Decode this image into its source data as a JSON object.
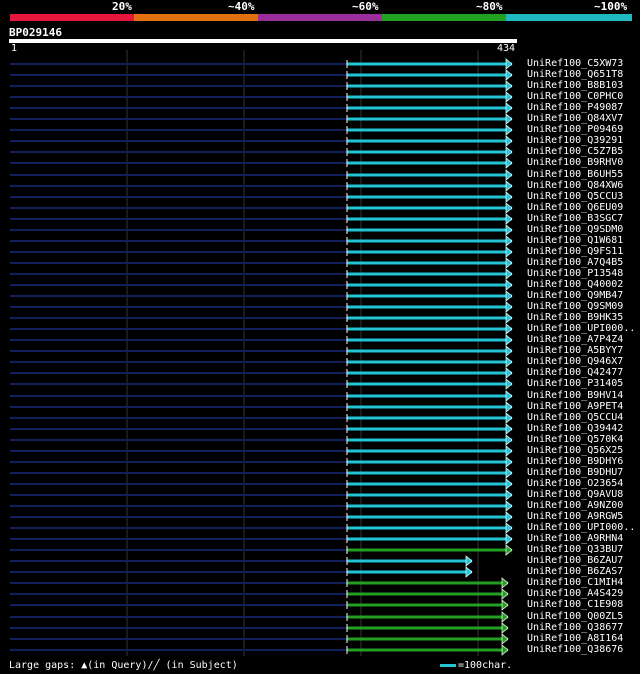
{
  "identity_scale": {
    "labels": [
      "20%",
      "~40%",
      "~60%",
      "~80%",
      "~100%"
    ],
    "colors": [
      "#e8163c",
      "#e07010",
      "#9b2e9b",
      "#22a022",
      "#20b8c0"
    ]
  },
  "query": {
    "name": "BP029146",
    "start": "1",
    "end": "434"
  },
  "hits": [
    {
      "name": "UniRef100_C5XW73",
      "color": "#22c4d6",
      "identity_pct": 100
    },
    {
      "name": "UniRef100_Q651T8",
      "color": "#22c4d6",
      "identity_pct": 100
    },
    {
      "name": "UniRef100_B8B103",
      "color": "#22c4d6",
      "identity_pct": 100
    },
    {
      "name": "UniRef100_C0PHC0",
      "color": "#22c4d6",
      "identity_pct": 100
    },
    {
      "name": "UniRef100_P49087",
      "color": "#22c4d6",
      "identity_pct": 100
    },
    {
      "name": "UniRef100_Q84XV7",
      "color": "#22c4d6",
      "identity_pct": 100
    },
    {
      "name": "UniRef100_P09469",
      "color": "#22c4d6",
      "identity_pct": 100
    },
    {
      "name": "UniRef100_Q39291",
      "color": "#22c4d6",
      "identity_pct": 100
    },
    {
      "name": "UniRef100_C5Z7B5",
      "color": "#22c4d6",
      "identity_pct": 100
    },
    {
      "name": "UniRef100_B9RHV0",
      "color": "#22c4d6",
      "identity_pct": 100
    },
    {
      "name": "UniRef100_B6UH55",
      "color": "#22c4d6",
      "identity_pct": 100
    },
    {
      "name": "UniRef100_Q84XW6",
      "color": "#22c4d6",
      "identity_pct": 100
    },
    {
      "name": "UniRef100_Q5CCU3",
      "color": "#22c4d6",
      "identity_pct": 100
    },
    {
      "name": "UniRef100_Q6EU09",
      "color": "#22c4d6",
      "identity_pct": 100
    },
    {
      "name": "UniRef100_B3SGC7",
      "color": "#22c4d6",
      "identity_pct": 100
    },
    {
      "name": "UniRef100_Q9SDM0",
      "color": "#22c4d6",
      "identity_pct": 100
    },
    {
      "name": "UniRef100_Q1W681",
      "color": "#22c4d6",
      "identity_pct": 100
    },
    {
      "name": "UniRef100_Q9FS11",
      "color": "#22c4d6",
      "identity_pct": 100
    },
    {
      "name": "UniRef100_A7Q4B5",
      "color": "#22c4d6",
      "identity_pct": 100
    },
    {
      "name": "UniRef100_P13548",
      "color": "#22c4d6",
      "identity_pct": 100
    },
    {
      "name": "UniRef100_Q40002",
      "color": "#22c4d6",
      "identity_pct": 100
    },
    {
      "name": "UniRef100_Q9MB47",
      "color": "#22c4d6",
      "identity_pct": 100
    },
    {
      "name": "UniRef100_Q9SM09",
      "color": "#22c4d6",
      "identity_pct": 100
    },
    {
      "name": "UniRef100_B9HK35",
      "color": "#22c4d6",
      "identity_pct": 100
    },
    {
      "name": "UniRef100_UPI000..",
      "color": "#22c4d6",
      "identity_pct": 100
    },
    {
      "name": "UniRef100_A7P4Z4",
      "color": "#22c4d6",
      "identity_pct": 100
    },
    {
      "name": "UniRef100_A5BYY7",
      "color": "#22c4d6",
      "identity_pct": 100
    },
    {
      "name": "UniRef100_Q946X7",
      "color": "#22c4d6",
      "identity_pct": 100
    },
    {
      "name": "UniRef100_Q42477",
      "color": "#22c4d6",
      "identity_pct": 100
    },
    {
      "name": "UniRef100_P31405",
      "color": "#22c4d6",
      "identity_pct": 100
    },
    {
      "name": "UniRef100_B9HV14",
      "color": "#22c4d6",
      "identity_pct": 100
    },
    {
      "name": "UniRef100_A9PET4",
      "color": "#22c4d6",
      "identity_pct": 100
    },
    {
      "name": "UniRef100_Q5CCU4",
      "color": "#22c4d6",
      "identity_pct": 100
    },
    {
      "name": "UniRef100_Q39442",
      "color": "#22c4d6",
      "identity_pct": 100
    },
    {
      "name": "UniRef100_Q570K4",
      "color": "#22c4d6",
      "identity_pct": 100
    },
    {
      "name": "UniRef100_Q56X25",
      "color": "#22c4d6",
      "identity_pct": 100
    },
    {
      "name": "UniRef100_B9DHY6",
      "color": "#22c4d6",
      "identity_pct": 100
    },
    {
      "name": "UniRef100_B9DHU7",
      "color": "#22c4d6",
      "identity_pct": 100
    },
    {
      "name": "UniRef100_O23654",
      "color": "#22c4d6",
      "identity_pct": 100
    },
    {
      "name": "UniRef100_Q9AVU8",
      "color": "#22c4d6",
      "identity_pct": 100
    },
    {
      "name": "UniRef100_A9NZ00",
      "color": "#22c4d6",
      "identity_pct": 100
    },
    {
      "name": "UniRef100_A9RGW5",
      "color": "#22c4d6",
      "identity_pct": 100
    },
    {
      "name": "UniRef100_UPI000..",
      "color": "#22c4d6",
      "identity_pct": 100
    },
    {
      "name": "UniRef100_A9RHN4",
      "color": "#22c4d6",
      "identity_pct": 100
    },
    {
      "name": "UniRef100_Q33BU7",
      "color": "#22a022",
      "identity_pct": 80
    },
    {
      "name": "UniRef100_B6ZAU7",
      "color": "#22c4d6",
      "identity_pct": 100
    },
    {
      "name": "UniRef100_B6ZAS7",
      "color": "#22c4d6",
      "identity_pct": 100
    },
    {
      "name": "UniRef100_C1MIH4",
      "color": "#22a022",
      "identity_pct": 80
    },
    {
      "name": "UniRef100_A4S429",
      "color": "#22a022",
      "identity_pct": 80
    },
    {
      "name": "UniRef100_C1E908",
      "color": "#22a022",
      "identity_pct": 80
    },
    {
      "name": "UniRef100_Q00ZL5",
      "color": "#22a022",
      "identity_pct": 80
    },
    {
      "name": "UniRef100_Q38677",
      "color": "#22a022",
      "identity_pct": 80
    },
    {
      "name": "UniRef100_A8I164",
      "color": "#22a022",
      "identity_pct": 80
    },
    {
      "name": "UniRef100_Q38676",
      "color": "#22a022",
      "identity_pct": 80
    }
  ],
  "footer": {
    "gaps_text": "Large gaps: ▲(in Query)/╱ (in Subject)",
    "legend_text": "=100char."
  }
}
